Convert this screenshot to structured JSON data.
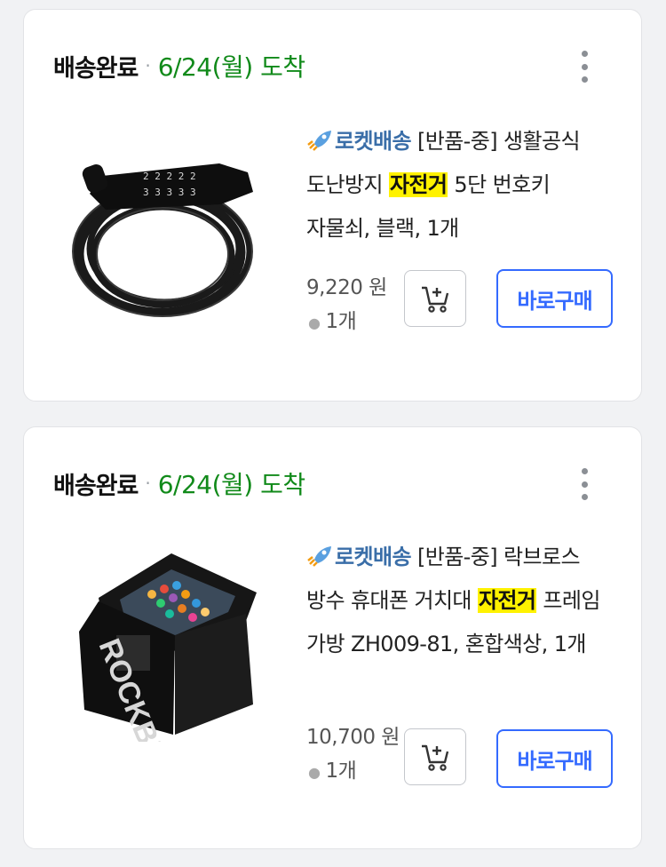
{
  "orders": [
    {
      "status": "배송완료",
      "arrival": "6/24(월) 도착",
      "badge": "로켓배송",
      "title_before": "[반품-중] 생활공식 도난방지 ",
      "highlight": "자전거",
      "title_after": " 5단 번호키 자물쇠, 블랙, 1개",
      "price": "9,220 원",
      "quantity": "1개",
      "buy_label": "바로구매",
      "thumbnail_icon": "cable-lock-photo"
    },
    {
      "status": "배송완료",
      "arrival": "6/24(월) 도착",
      "badge": "로켓배송",
      "title_before": "[반품-중] 락브로스 방수 휴대폰 거치대 ",
      "highlight": "자전거",
      "title_after": " 프레임 가방 ZH009-81, 혼합색상, 1개",
      "price": "10,700 원",
      "quantity": "1개",
      "buy_label": "바로구매",
      "thumbnail_icon": "bike-frame-bag-photo",
      "brand_print": "ROCKBROS"
    }
  ],
  "icons": {
    "more": "kebab-icon",
    "cart": "add-to-cart-icon",
    "rocket": "rocket-icon"
  },
  "colors": {
    "arrival": "#118a1a",
    "badge": "#3a6ea8",
    "buy_button": "#346aff",
    "highlight": "#fff200"
  }
}
